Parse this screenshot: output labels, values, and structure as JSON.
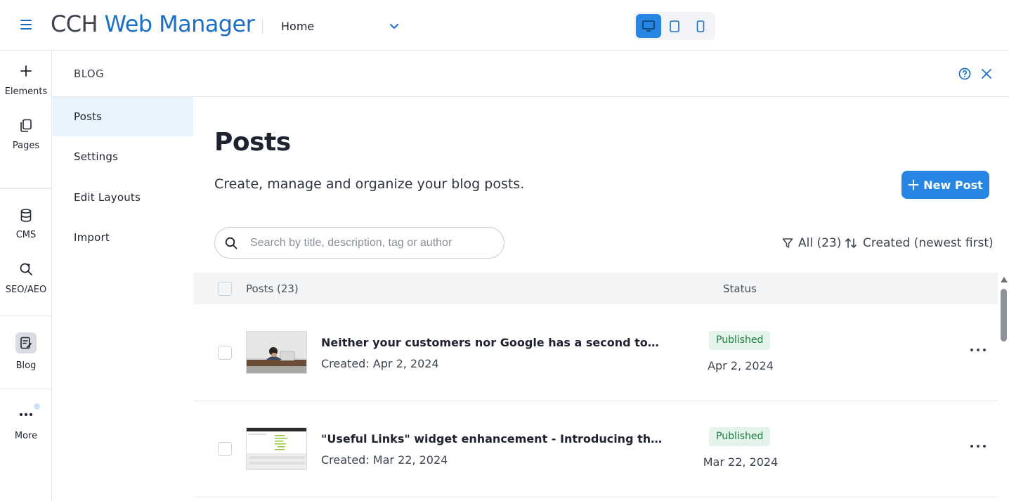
{
  "app": {
    "logo_part1": "CCH",
    "logo_part2": "Web Manager",
    "page_select_value": "Home",
    "accent": "#2786e3",
    "brand_blue": "#1a6fc7"
  },
  "rail": {
    "items": [
      {
        "label": "Elements",
        "icon": "plus-icon"
      },
      {
        "label": "Pages",
        "icon": "pages-icon"
      },
      {
        "label": "CMS",
        "icon": "database-icon"
      },
      {
        "label": "SEO/AEO",
        "icon": "seo-icon"
      },
      {
        "label": "Blog",
        "icon": "blog-icon"
      },
      {
        "label": "More",
        "icon": "more-icon"
      }
    ]
  },
  "panel": {
    "title": "BLOG",
    "subnav": [
      {
        "label": "Posts",
        "active": true
      },
      {
        "label": "Settings"
      },
      {
        "label": "Edit Layouts"
      },
      {
        "label": "Import"
      }
    ]
  },
  "main": {
    "title": "Posts",
    "subtitle": "Create, manage and organize your blog posts.",
    "new_post_label": "New Post",
    "search_placeholder": "Search by title, description, tag or author",
    "filter_label": "All (23)",
    "sort_label": "Created (newest first)",
    "table": {
      "col_posts": "Posts (23)",
      "col_status": "Status",
      "rows": [
        {
          "title": "Neither your customers nor Google has a second to spare ...",
          "created": "Created: Apr 2, 2024",
          "status": "Published",
          "status_date": "Apr 2, 2024"
        },
        {
          "title": "\"Useful Links\" widget enhancement - Introducing the late...",
          "created": "Created: Mar 22, 2024",
          "status": "Published",
          "status_date": "Mar 22, 2024"
        }
      ]
    }
  }
}
